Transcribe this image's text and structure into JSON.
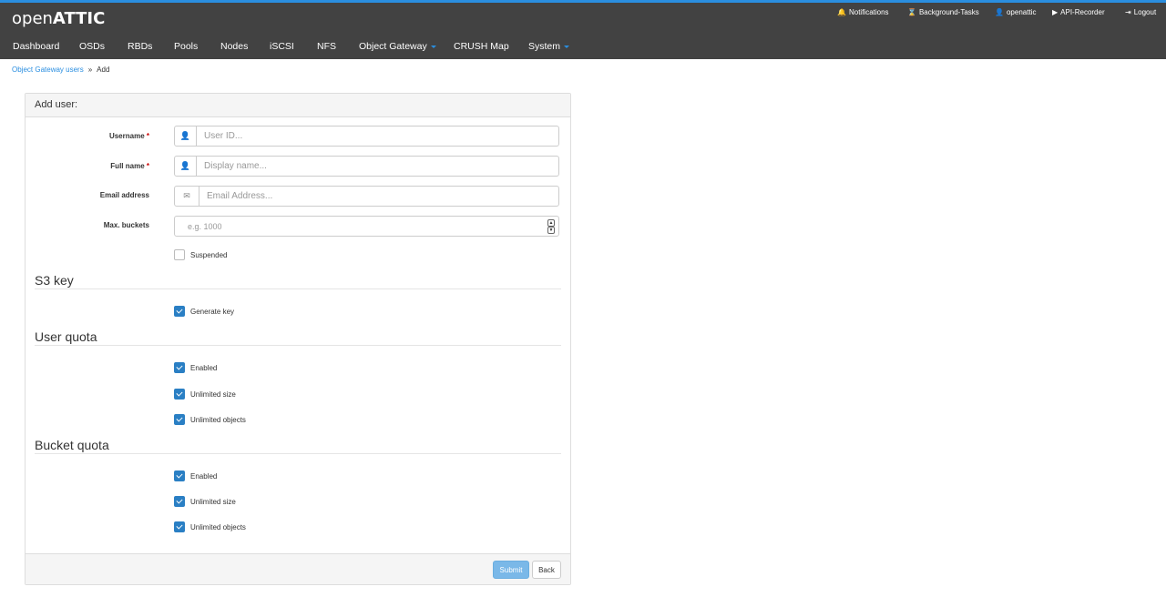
{
  "app": {
    "logo_open": "open",
    "logo_attic": "ATTIC",
    "brand_color": "#2a8ee0"
  },
  "util": {
    "notifications": "Notifications",
    "background_tasks": "Background-Tasks",
    "user": "openattic",
    "api_recorder": "API-Recorder",
    "logout": "Logout"
  },
  "nav": {
    "dashboard": "Dashboard",
    "osds": "OSDs",
    "rbds": "RBDs",
    "pools": "Pools",
    "nodes": "Nodes",
    "iscsi": "iSCSI",
    "nfs": "NFS",
    "object_gateway": "Object Gateway",
    "crush_map": "CRUSH Map",
    "system": "System"
  },
  "breadcrumb": {
    "parent": "Object Gateway users",
    "sep": "»",
    "current": "Add"
  },
  "form": {
    "title": "Add user:",
    "username": {
      "label": "Username",
      "placeholder": "User ID..."
    },
    "fullname": {
      "label": "Full name",
      "placeholder": "Display name..."
    },
    "email": {
      "label": "Email address",
      "placeholder": "Email Address..."
    },
    "max_buckets": {
      "label": "Max. buckets",
      "placeholder": "e.g. 1000"
    },
    "required_mark": "*",
    "suspended": {
      "label": "Suspended",
      "checked": false
    },
    "s3_section": "S3 key",
    "generate_key": {
      "label": "Generate key",
      "checked": true
    },
    "user_quota_section": "User quota",
    "user_quota": {
      "enabled": {
        "label": "Enabled",
        "checked": true
      },
      "unlimited_size": {
        "label": "Unlimited size",
        "checked": true
      },
      "unlimited_objects": {
        "label": "Unlimited objects",
        "checked": true
      }
    },
    "bucket_quota_section": "Bucket quota",
    "bucket_quota": {
      "enabled": {
        "label": "Enabled",
        "checked": true
      },
      "unlimited_size": {
        "label": "Unlimited size",
        "checked": true
      },
      "unlimited_objects": {
        "label": "Unlimited objects",
        "checked": true
      }
    },
    "submit": "Submit",
    "back": "Back"
  }
}
